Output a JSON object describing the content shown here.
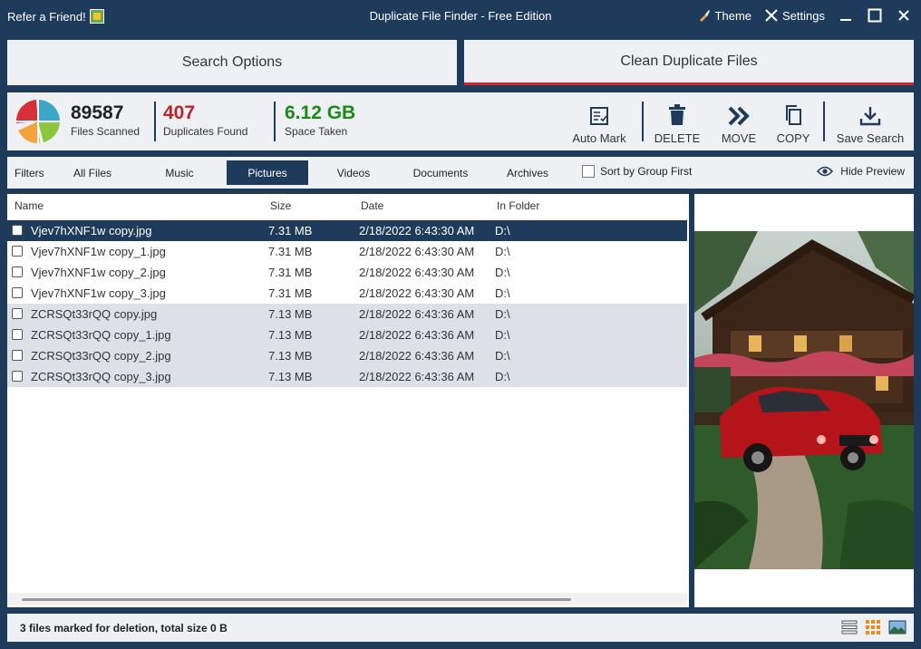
{
  "titlebar": {
    "refer": "Refer a Friend!",
    "title": "Duplicate File Finder - Free Edition",
    "theme": "Theme",
    "settings": "Settings"
  },
  "tabs": {
    "search_options": "Search Options",
    "clean": "Clean Duplicate Files"
  },
  "stats": {
    "files_scanned_value": "89587",
    "files_scanned_label": "Files Scanned",
    "duplicates_value": "407",
    "duplicates_label": "Duplicates Found",
    "space_value": "6.12 GB",
    "space_label": "Space Taken"
  },
  "actions": {
    "auto_mark": "Auto Mark",
    "delete": "DELETE",
    "move": "MOVE",
    "copy": "COPY",
    "save_search": "Save Search"
  },
  "filters": {
    "label": "Filters",
    "tabs": [
      "All Files",
      "Music",
      "Pictures",
      "Videos",
      "Documents",
      "Archives"
    ],
    "active": "Pictures",
    "sort_by_group": "Sort by Group First",
    "hide_preview": "Hide Preview"
  },
  "table": {
    "headers": {
      "name": "Name",
      "size": "Size",
      "date": "Date",
      "folder": "In Folder"
    },
    "rows": [
      {
        "name": "Vjev7hXNF1w copy.jpg",
        "size": "7.31 MB",
        "date": "2/18/2022 6:43:30 AM",
        "folder": "D:\\"
      },
      {
        "name": "Vjev7hXNF1w copy_1.jpg",
        "size": "7.31 MB",
        "date": "2/18/2022 6:43:30 AM",
        "folder": "D:\\"
      },
      {
        "name": "Vjev7hXNF1w copy_2.jpg",
        "size": "7.31 MB",
        "date": "2/18/2022 6:43:30 AM",
        "folder": "D:\\"
      },
      {
        "name": "Vjev7hXNF1w copy_3.jpg",
        "size": "7.31 MB",
        "date": "2/18/2022 6:43:30 AM",
        "folder": "D:\\"
      },
      {
        "name": "ZCRSQt33rQQ copy.jpg",
        "size": "7.13 MB",
        "date": "2/18/2022 6:43:36 AM",
        "folder": "D:\\"
      },
      {
        "name": "ZCRSQt33rQQ copy_1.jpg",
        "size": "7.13 MB",
        "date": "2/18/2022 6:43:36 AM",
        "folder": "D:\\"
      },
      {
        "name": "ZCRSQt33rQQ copy_2.jpg",
        "size": "7.13 MB",
        "date": "2/18/2022 6:43:36 AM",
        "folder": "D:\\"
      },
      {
        "name": "ZCRSQt33rQQ copy_3.jpg",
        "size": "7.13 MB",
        "date": "2/18/2022 6:43:36 AM",
        "folder": "D:\\"
      }
    ]
  },
  "status": {
    "text": "3 files marked for deletion, total size 0 B"
  },
  "colors": {
    "frame": "#1f3b5c",
    "accent_red": "#b8232d",
    "accent_green": "#1a8a1a",
    "tab_underline": "#d6202b"
  }
}
